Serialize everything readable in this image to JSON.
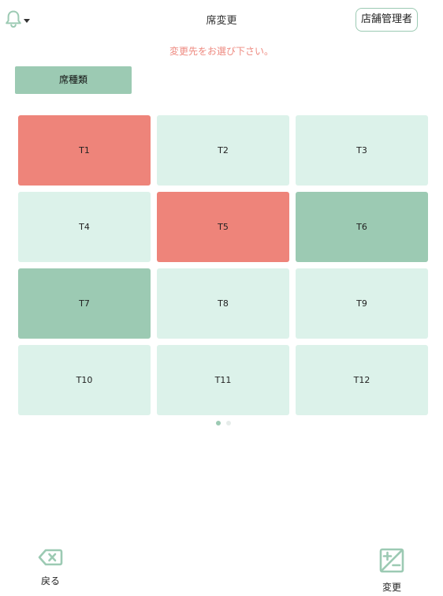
{
  "header": {
    "title": "席変更",
    "user_button_label": "店舗管理者",
    "bell_icon": "bell-icon",
    "caret_icon": "caret-down-icon"
  },
  "instruction": "変更先をお選び下さい。",
  "seat_type_button": "席種類",
  "tables": [
    {
      "label": "T1",
      "status": "occupied"
    },
    {
      "label": "T2",
      "status": "empty"
    },
    {
      "label": "T3",
      "status": "empty"
    },
    {
      "label": "T4",
      "status": "empty"
    },
    {
      "label": "T5",
      "status": "occupied"
    },
    {
      "label": "T6",
      "status": "selected"
    },
    {
      "label": "T7",
      "status": "selected"
    },
    {
      "label": "T8",
      "status": "empty"
    },
    {
      "label": "T9",
      "status": "empty"
    },
    {
      "label": "T10",
      "status": "empty"
    },
    {
      "label": "T11",
      "status": "empty"
    },
    {
      "label": "T12",
      "status": "empty"
    }
  ],
  "pagination": {
    "pages": 2,
    "current": 1
  },
  "footer": {
    "back_label": "戻る",
    "back_icon": "backspace-icon",
    "change_label": "変更",
    "change_icon": "plus-minus-icon"
  },
  "colors": {
    "accent": "#9ccab3",
    "occupied": "#ee847a",
    "empty": "#dcf2ea",
    "instruction": "#ee8a80"
  }
}
